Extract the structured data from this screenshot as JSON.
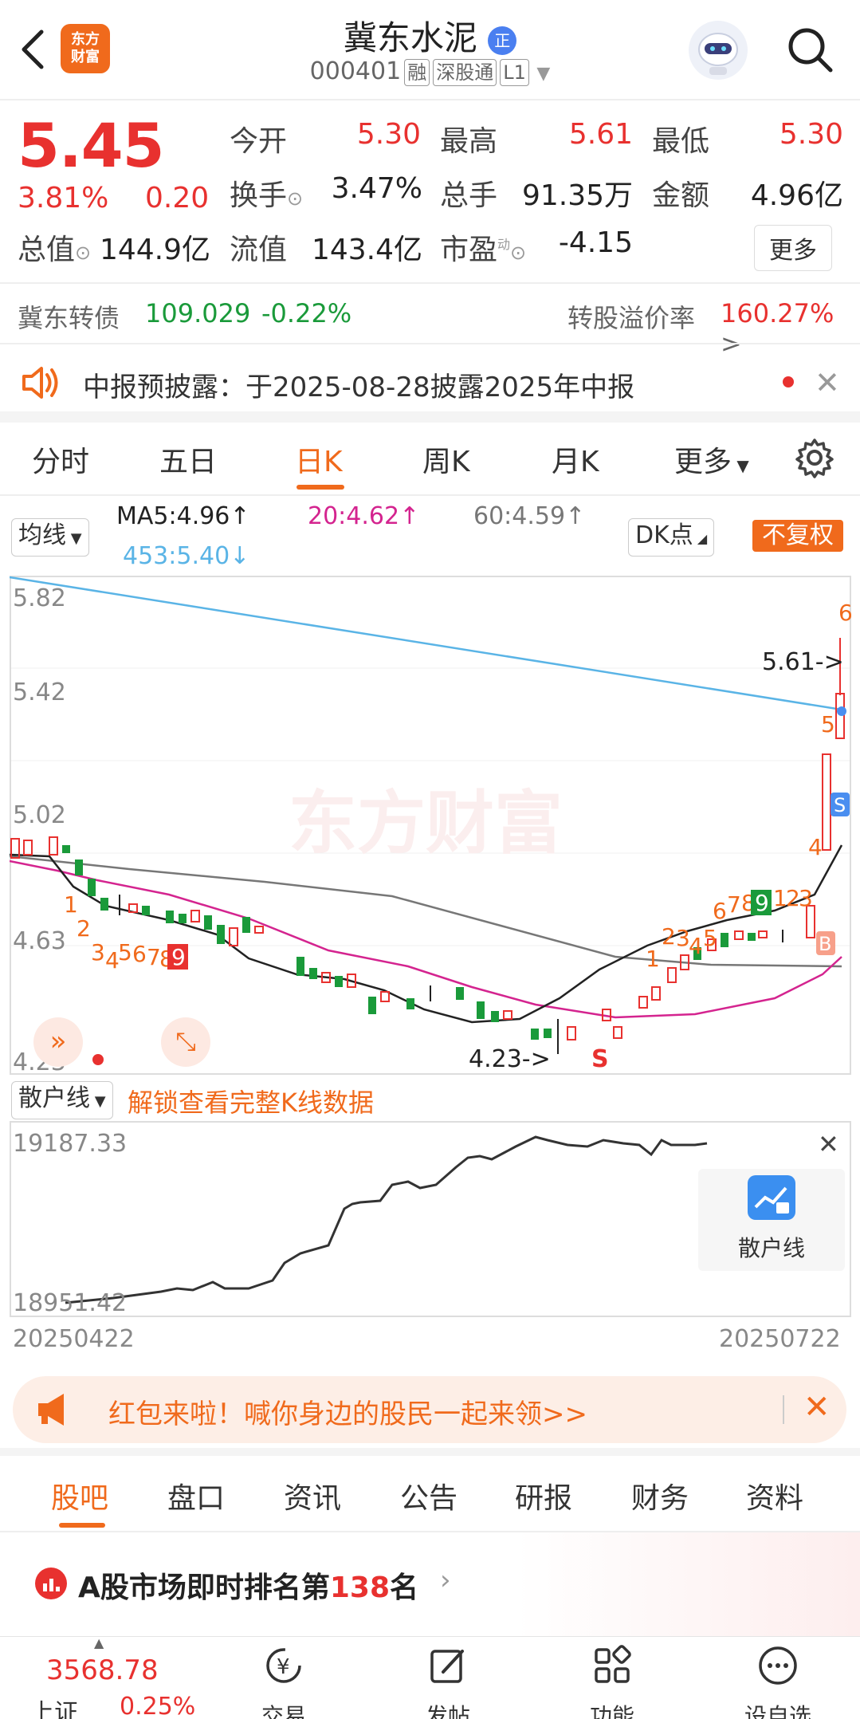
{
  "header": {
    "title": "冀东水泥",
    "code": "000401",
    "tags": [
      "融",
      "深股通",
      "L1"
    ],
    "logo_text_line1": "东方",
    "logo_text_line2": "财富",
    "verified_badge": "正"
  },
  "quote": {
    "price": "5.45",
    "change_pct": "3.81%",
    "change": "0.20",
    "open_label": "今开",
    "open": "5.30",
    "high_label": "最高",
    "high": "5.61",
    "low_label": "最低",
    "low": "5.30",
    "turnover_label": "换手",
    "turnover": "3.47%",
    "volume_label": "总手",
    "volume": "91.35万",
    "amount_label": "金额",
    "amount": "4.96亿",
    "mktcap_label": "总值",
    "mktcap": "144.9亿",
    "float_label": "流值",
    "float": "143.4亿",
    "pe_label": "市盈",
    "pe_sup": "动",
    "pe": "-4.15",
    "more_label": "更多"
  },
  "bond": {
    "name": "冀东转债",
    "price": "109.029",
    "change": "-0.22%",
    "premium_label": "转股溢价率",
    "premium": "160.27%"
  },
  "notice": {
    "text": "中报预披露：于2025-08-28披露2025年中报"
  },
  "chart_tabs": [
    "分时",
    "五日",
    "日K",
    "周K",
    "月K",
    "更多"
  ],
  "chart_tab_active": "日K",
  "ma_bar": {
    "selector": "均线",
    "ma5": "MA5:4.96",
    "ma20": "20:4.62",
    "ma60": "60:4.59",
    "ma453": "453:5.40",
    "dk": "DK点",
    "adjust": "不复权"
  },
  "kline": {
    "y_labels": [
      "5.82",
      "5.42",
      "5.02",
      "4.63",
      "4.23"
    ],
    "high_marker": "5.61->",
    "low_marker": "4.23->",
    "signal_s": "S",
    "signal_b": "B",
    "signal_s_small": "S"
  },
  "retail": {
    "selector": "散户线",
    "unlock": "解锁查看完整K线数据",
    "y_top": "19187.33",
    "y_bottom": "18951.42",
    "date_start": "20250422",
    "date_end": "20250722",
    "card_label": "散户线"
  },
  "promo": {
    "text": "红包来啦！喊你身边的股民一起来领>>"
  },
  "bottom_tabs": [
    "股吧",
    "盘口",
    "资讯",
    "公告",
    "研报",
    "财务",
    "资料"
  ],
  "bottom_tab_active": "股吧",
  "ranking": {
    "prefix": "A股市场即时排名第",
    "rank": "138",
    "suffix": "名"
  },
  "bottom_nav": {
    "index_value": "3568.78",
    "index_name": "上证",
    "index_change": "0.25%",
    "items": [
      "交易",
      "发帖",
      "功能",
      "设自选"
    ]
  },
  "colors": {
    "up": "#e8312f",
    "down": "#1a9a3a",
    "accent": "#f06a1c",
    "ma5": "#222222",
    "ma20": "#d4248f",
    "ma60": "#777777",
    "ma453": "#5ab4e6"
  }
}
